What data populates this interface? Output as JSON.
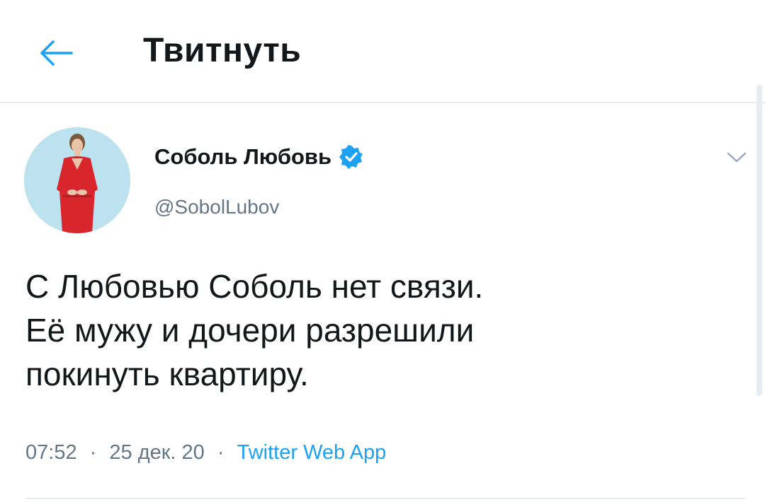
{
  "header": {
    "title": "Твитнуть",
    "back_icon": "arrow-left-icon"
  },
  "tweet": {
    "author": {
      "name": "Соболь Любовь",
      "handle": "@SobolLubov",
      "verified": true,
      "verified_icon": "verified-badge-icon"
    },
    "text": "С Любовью Соболь нет связи.\nЕё мужу и дочери разрешили\nпокинуть квартиру.",
    "time": "07:52",
    "date": "25 дек. 20",
    "separator": "·",
    "source": "Twitter Web App",
    "menu_icon": "chevron-down-icon"
  },
  "colors": {
    "accent": "#1da1f2",
    "text": "#14171a",
    "secondary_text": "#657786",
    "divider": "#e6ecf0"
  }
}
